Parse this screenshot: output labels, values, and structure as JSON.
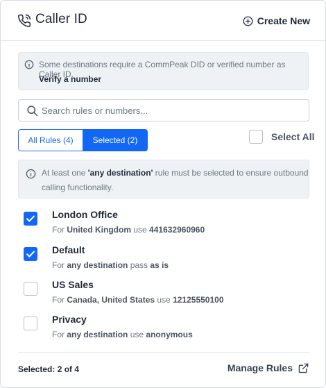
{
  "header": {
    "title": "Caller ID",
    "create_label": "Create New"
  },
  "info": {
    "text": "Some destinations require a CommPeak DID or verified number as Caller ID.",
    "link": "Verify a number"
  },
  "search": {
    "placeholder": "Search rules or numbers..."
  },
  "tabs": {
    "all": "All Rules (4)",
    "selected": "Selected (2)",
    "active": "selected"
  },
  "select_all": "Select All",
  "warning": {
    "prefix": "At least one ",
    "highlight": "'any destination'",
    "suffix": " rule must be selected to ensure outbound",
    "line2": "calling functionality."
  },
  "rules": [
    {
      "name": "London Office",
      "checked": true,
      "w1": "For",
      "target": "United Kingdom",
      "w2": "use",
      "value": "441632960960"
    },
    {
      "name": "Default",
      "checked": true,
      "w1": "For",
      "target": "any destination",
      "w2": "pass",
      "value": "as is"
    },
    {
      "name": "US Sales",
      "checked": false,
      "w1": "For",
      "target": "Canada, United States",
      "w2": "use",
      "value": "12125550100"
    },
    {
      "name": "Privacy",
      "checked": false,
      "w1": "For",
      "target": "any destination",
      "w2": "use",
      "value": "anonymous"
    }
  ],
  "footer": {
    "count": "Selected: 2 of 4",
    "manage": "Manage Rules"
  },
  "colors": {
    "accent": "#1267f4",
    "info_bg": "#eef2f5",
    "muted_text": "#6b7784"
  },
  "icons": [
    "phone-icon",
    "plus-circle-icon",
    "info-icon",
    "search-icon",
    "checkmark-icon",
    "external-link-icon"
  ]
}
